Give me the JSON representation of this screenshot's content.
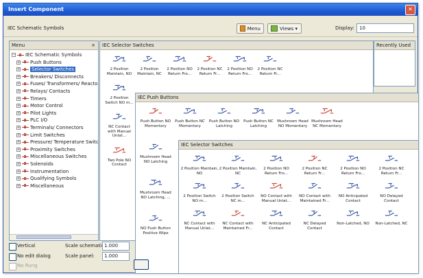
{
  "window": {
    "title": "Insert Component",
    "close": "✕"
  },
  "library": {
    "label": "IEC Schematic Symbols"
  },
  "toolbar": {
    "menu_label": "Menu",
    "views_label": "Views ▾",
    "display_label": "Display:",
    "display_value": "10"
  },
  "menu_panel": {
    "header": "Menu",
    "close": "×",
    "root": "IEC Schematic Symbols",
    "items": [
      {
        "label": "Push Buttons",
        "selected": false
      },
      {
        "label": "Selector Switches",
        "selected": true
      },
      {
        "label": "Breakers/ Disconnects",
        "selected": false
      },
      {
        "label": "Fuses/ Transformers/ Reactors",
        "selected": false
      },
      {
        "label": "Relays/ Contacts",
        "selected": false
      },
      {
        "label": "Timers",
        "selected": false
      },
      {
        "label": "Motor Control",
        "selected": false
      },
      {
        "label": "Pilot Lights",
        "selected": false
      },
      {
        "label": "PLC I/O",
        "selected": false
      },
      {
        "label": "Terminals/ Connectors",
        "selected": false
      },
      {
        "label": "Limit Switches",
        "selected": false
      },
      {
        "label": "Pressure/ Temperature Switches",
        "selected": false
      },
      {
        "label": "Proximity Switches",
        "selected": false
      },
      {
        "label": "Miscellaneous Switches",
        "selected": false
      },
      {
        "label": "Solenoids",
        "selected": false
      },
      {
        "label": "Instrumentation",
        "selected": false
      },
      {
        "label": "Qualifying Symbols",
        "selected": false
      },
      {
        "label": "Miscellaneous",
        "selected": false
      }
    ]
  },
  "selector_panel_back": {
    "header": "IEC Selector Switches",
    "items": [
      {
        "label": "2 Position Maintain, NO"
      },
      {
        "label": "2 Position Maintain, NC"
      },
      {
        "label": "2 Position NO Return Fro..."
      },
      {
        "label": "2 Position NC Return Fr..."
      },
      {
        "label": "2 Position NO Return Fro..."
      },
      {
        "label": "2 Position NC Return Fr..."
      },
      {
        "label": "2 Position Switch NO m..."
      },
      {
        "label": "NC Contact with Manual Unlat..."
      },
      {
        "label": "Two Pole NO Contact"
      }
    ]
  },
  "recent_panel": {
    "header": "Recently Used"
  },
  "pushbutton_panel": {
    "header": "IEC Push Buttons",
    "items": [
      {
        "label": "Push Button NO Momentary"
      },
      {
        "label": "Push Button NC Momentary"
      },
      {
        "label": "Push Button NO Latching"
      },
      {
        "label": "Push Button NC Latching"
      },
      {
        "label": "Mushroom Head NO Momentary"
      },
      {
        "label": "Mushroom Head NC Momentary"
      },
      {
        "label": "Mushroom Head NO Latching"
      },
      {
        "label": "Mushroom Head NO Latching, ..."
      },
      {
        "label": "NO Push Button Positive Wipe"
      }
    ]
  },
  "selector_panel_front": {
    "header": "IEC Selector Switches",
    "items": [
      {
        "label": "2 Position Maintain, NO"
      },
      {
        "label": "2 Position Maintain, NC"
      },
      {
        "label": "2 Position NO Return Fro..."
      },
      {
        "label": "2 Position NC Return Fr..."
      },
      {
        "label": "2 Position NO Return Fro..."
      },
      {
        "label": "2 Position NC Return Fr..."
      },
      {
        "label": "2 Position Switch NO m..."
      },
      {
        "label": "2 Position Switch NC m..."
      },
      {
        "label": "NO Contact with Manual Unlat..."
      },
      {
        "label": "NO Contact with Maintained Fr..."
      },
      {
        "label": "NO Anticipated Contact"
      },
      {
        "label": "NO Delayed Contact"
      },
      {
        "label": "NC Contact with Manual Unlat..."
      },
      {
        "label": "NC Contact with Maintained Fr..."
      },
      {
        "label": "NC Anticipated Contact"
      },
      {
        "label": "NC Delayed Contact"
      },
      {
        "label": "Non-Latched, NO"
      },
      {
        "label": "Non-Latched, NC"
      }
    ]
  },
  "bottom": {
    "vertical_label": "Vertical",
    "no_edit_label": "No edit dialog",
    "no_edit_sub": "No Rung",
    "scale_schematic_label": "Scale schematic:",
    "scale_schematic_value": "1.000",
    "scale_panel_label": "Scale panel:",
    "scale_panel_value": "1.000"
  },
  "colors": {
    "title_bar": "#1e5bd6",
    "selection": "#316ac5",
    "symbol_red": "#c0392b",
    "symbol_blue": "#2c4c9c"
  }
}
